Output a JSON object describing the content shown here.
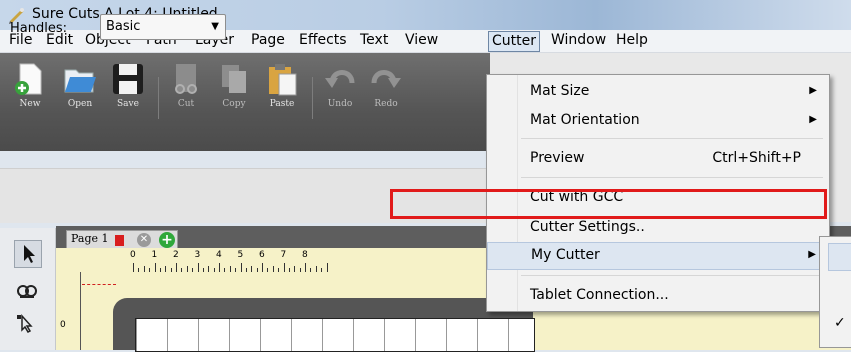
{
  "window": {
    "title": "Sure Cuts A Lot 4: Untitled"
  },
  "menubar": {
    "items": [
      "File",
      "Edit",
      "Object",
      "Path",
      "Layer",
      "Page",
      "Effects",
      "Text",
      "View",
      "Cutter",
      "Window",
      "Help"
    ],
    "active": "Cutter"
  },
  "toolbar": {
    "new": "New",
    "open": "Open",
    "save": "Save",
    "cut": "Cut",
    "copy": "Copy",
    "paste": "Paste",
    "undo": "Undo",
    "redo": "Redo"
  },
  "handles": {
    "label": "Handles:",
    "value": "Basic"
  },
  "page_tab": {
    "label": "Page 1"
  },
  "ruler": {
    "numbers": [
      "0",
      "1",
      "2",
      "3",
      "4",
      "5",
      "6",
      "7",
      "8"
    ],
    "v_number": "0"
  },
  "cutter_menu": {
    "mat_size": "Mat Size",
    "mat_orientation": "Mat Orientation",
    "preview": "Preview",
    "preview_shortcut": "Ctrl+Shift+P",
    "cut_with_gcc": "Cut with GCC",
    "cutter_settings": "Cutter Settings..",
    "my_cutter": "My Cutter",
    "tablet_connection": "Tablet Connection..."
  },
  "submenu": {
    "checked_glyph": "✓"
  },
  "colors": {
    "highlight": "#e11a1a",
    "page_color": "#d81e1e",
    "add_tab": "#2fa83a"
  },
  "icons": [
    "app-icon",
    "new-icon",
    "open-icon",
    "save-icon",
    "cut-icon",
    "copy-icon",
    "paste-icon",
    "undo-icon",
    "redo-icon",
    "select-arrow-icon",
    "node-edit-icon",
    "weld-icon",
    "close-icon",
    "add-icon",
    "submenu-arrow-icon",
    "checkmark-icon"
  ]
}
